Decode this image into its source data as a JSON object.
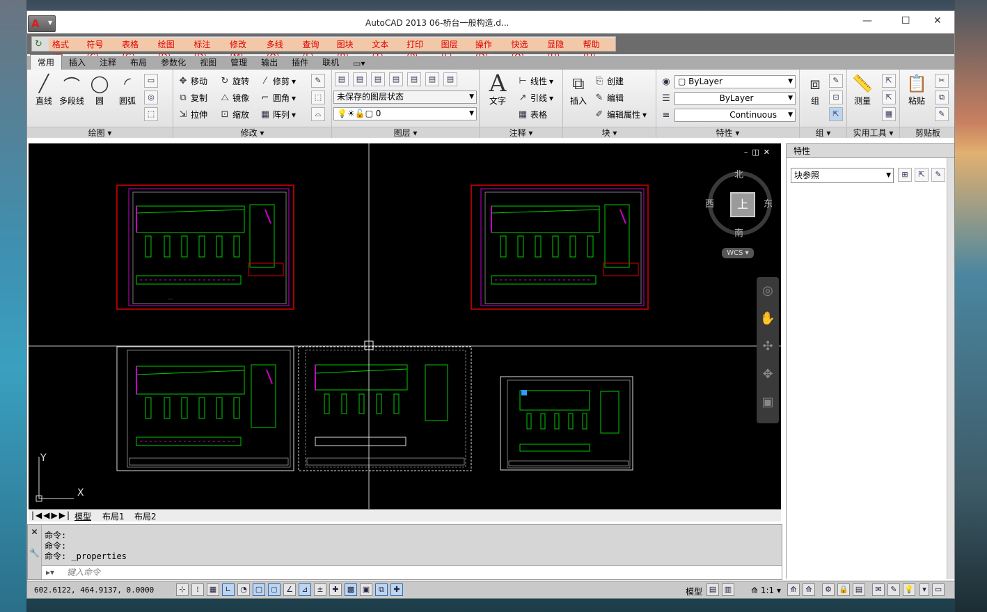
{
  "window": {
    "title": "AutoCAD 2013      06-桥台一般构造.d...",
    "minimize": "—",
    "maximize": "☐",
    "close": "✕"
  },
  "menubar": {
    "items": [
      "格式(F)",
      "符号(C)",
      "表格(G)",
      "绘图(D)",
      "标注(D)",
      "修改(M)",
      "多线(Q)",
      "查询(L)",
      "图块(B)",
      "文本(T)",
      "打印(P)",
      "图层(L)",
      "操作(D)",
      "快选(Q)",
      "显隐(H)",
      "帮助(H)"
    ]
  },
  "tabs": [
    "常用",
    "插入",
    "注释",
    "布局",
    "参数化",
    "视图",
    "管理",
    "输出",
    "插件",
    "联机"
  ],
  "ribbon": {
    "draw": {
      "title": "绘图",
      "line": "直线",
      "pline": "多段线",
      "circle": "圆",
      "arc": "圆弧"
    },
    "modify": {
      "title": "修改",
      "move": "移动",
      "rotate": "旋转",
      "trim": "修剪",
      "copy": "复制",
      "mirror": "镜像",
      "fillet": "圆角",
      "stretch": "拉伸",
      "scale": "缩放",
      "array": "阵列"
    },
    "layer": {
      "title": "图层",
      "state": "未保存的图层状态",
      "current": "0"
    },
    "annotation": {
      "title": "注释",
      "text": "文字",
      "linear": "线性",
      "leader": "引线",
      "table": "表格"
    },
    "block": {
      "title": "块",
      "insert": "插入",
      "create": "创建",
      "edit": "编辑",
      "editattr": "编辑属性"
    },
    "properties": {
      "title": "特性",
      "color": "ByLayer",
      "lineweight": "ByLayer",
      "linetype": "Continuous"
    },
    "group": {
      "title": "组",
      "group": "组"
    },
    "utilities": {
      "title": "实用工具",
      "measure": "测量"
    },
    "clipboard": {
      "title": "剪贴板",
      "paste": "粘贴"
    }
  },
  "viewcube": {
    "north": "北",
    "south": "南",
    "east": "东",
    "west": "西",
    "top": "上",
    "wcs": "WCS"
  },
  "ucs": {
    "x": "X",
    "y": "Y"
  },
  "layout_tabs": [
    "模型",
    "布局1",
    "布局2"
  ],
  "command": {
    "history": [
      "命令:",
      "命令:",
      "命令: _properties"
    ],
    "placeholder": "键入命令"
  },
  "status": {
    "coords": "602.6122,  464.9137, 0.0000",
    "model": "模型",
    "scale": "1:1"
  },
  "properties_panel": {
    "title": "特性",
    "selection": "块参照"
  }
}
